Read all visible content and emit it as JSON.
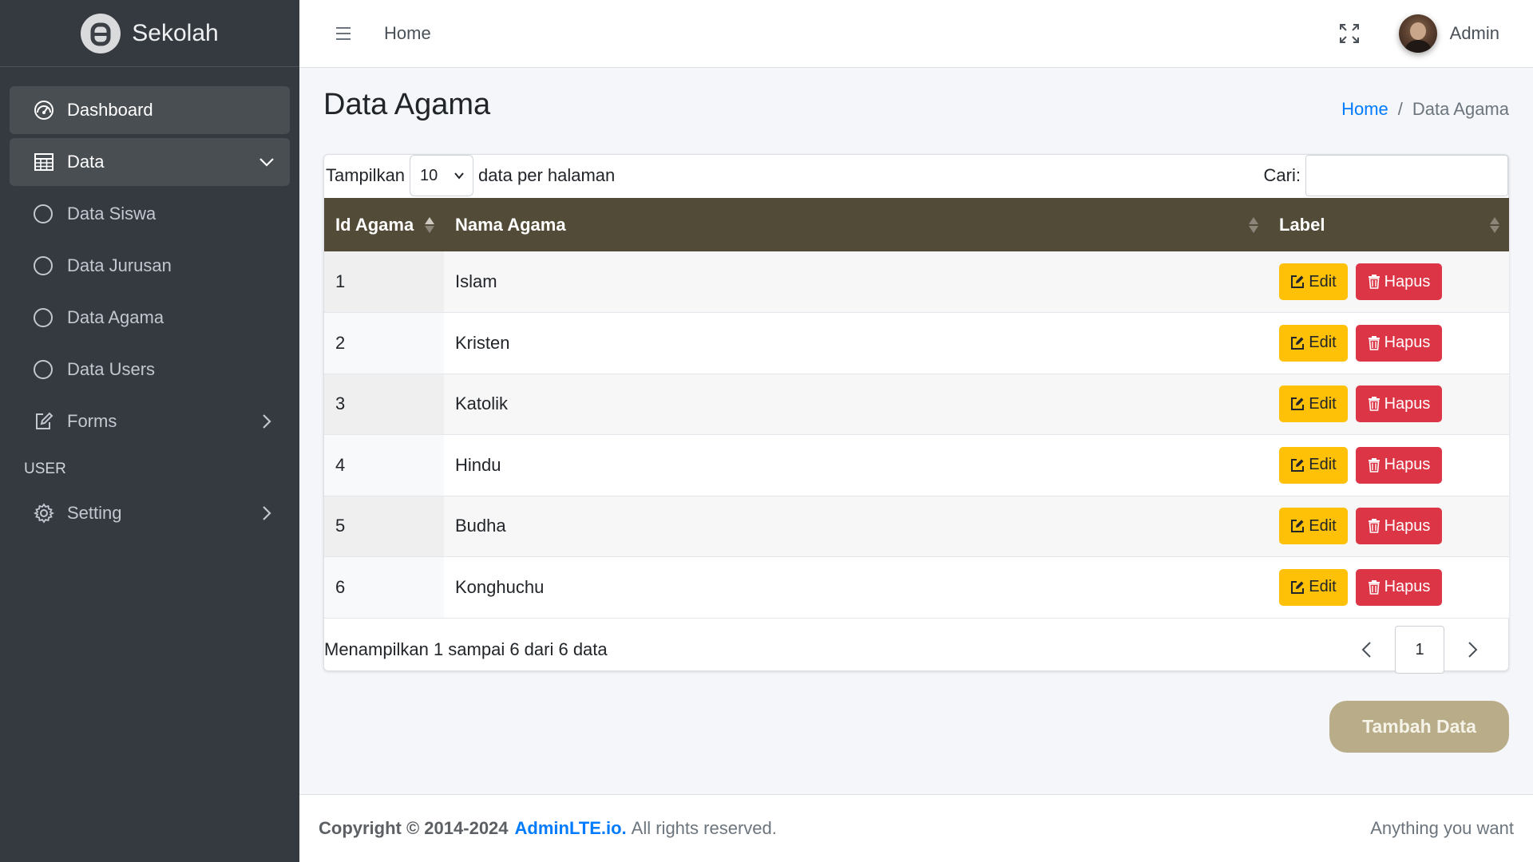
{
  "brand": {
    "name": "Sekolah"
  },
  "sidebar": {
    "dashboard": "Dashboard",
    "data": "Data",
    "sub_items": [
      "Data Siswa",
      "Data Jurusan",
      "Data Agama",
      "Data Users"
    ],
    "forms": "Forms",
    "user_header": "USER",
    "setting": "Setting"
  },
  "topbar": {
    "home": "Home",
    "user": "Admin"
  },
  "page": {
    "title": "Data Agama",
    "breadcrumb_home": "Home",
    "breadcrumb_sep": "/",
    "breadcrumb_current": "Data Agama"
  },
  "controls": {
    "length_prefix": "Tampilkan",
    "length_value": "10",
    "length_suffix": "data per halaman",
    "search_label": "Cari:",
    "search_value": ""
  },
  "table": {
    "headers": [
      "Id Agama",
      "Nama Agama",
      "Label"
    ],
    "rows": [
      {
        "id": "1",
        "name": "Islam"
      },
      {
        "id": "2",
        "name": "Kristen"
      },
      {
        "id": "3",
        "name": "Katolik"
      },
      {
        "id": "4",
        "name": "Hindu"
      },
      {
        "id": "5",
        "name": "Budha"
      },
      {
        "id": "6",
        "name": "Konghuchu"
      }
    ],
    "edit_label": "Edit",
    "delete_label": "Hapus"
  },
  "info": "Menampilkan 1 sampai 6 dari 6 data",
  "pager": {
    "current": "1"
  },
  "add_button": "Tambah Data",
  "footer": {
    "copyright": "Copyright © 2014-2024",
    "link": "AdminLTE.io.",
    "rights": "All rights reserved.",
    "right": "Anything you want"
  },
  "colors": {
    "sidebar_bg": "#343a40",
    "table_header": "#524b37",
    "edit": "#ffc107",
    "delete": "#dc3545",
    "add_button": "#b8ad88",
    "link": "#007bff"
  }
}
